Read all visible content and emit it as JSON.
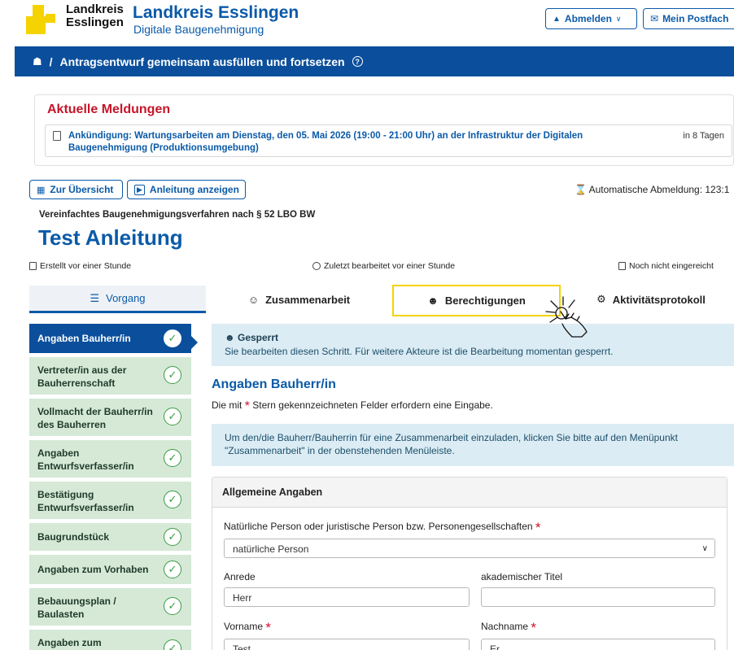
{
  "header": {
    "logo_line1": "Landkreis",
    "logo_line2": "Esslingen",
    "title": "Landkreis Esslingen",
    "subtitle": "Digitale Baugenehmigung",
    "logout_label": "Abmelden",
    "inbox_label": "Mein Postfach"
  },
  "bluebar": {
    "separator": "/",
    "title": "Antragsentwurf gemeinsam ausfüllen und fortsetzen",
    "help": "?"
  },
  "news": {
    "title": "Aktuelle Meldungen",
    "items": [
      {
        "text": "Ankündigung: Wartungsarbeiten am Dienstag, den 05. Mai 2026 (19:00 - 21:00 Uhr) an der Infrastruktur der Digitalen Baugenehmigung (Produktionsumgebung)",
        "when": "in 8 Tagen"
      }
    ]
  },
  "actions": {
    "overview_label": "Zur Übersicht",
    "manual_label": "Anleitung anzeigen",
    "autologout": "Automatische Abmeldung: 123:1"
  },
  "procedure": {
    "type": "Vereinfachtes Baugenehmigungsverfahren nach § 52 LBO BW",
    "title": "Test Anleitung",
    "created": "Erstellt vor einer Stunde",
    "edited": "Zuletzt bearbeitet vor einer Stunde",
    "submitted": "Noch nicht eingereicht"
  },
  "tabs": [
    {
      "label": "Vorgang"
    },
    {
      "label": "Zusammenarbeit"
    },
    {
      "label": "Berechtigungen"
    },
    {
      "label": "Aktivitätsprotokoll"
    }
  ],
  "sidebar": {
    "check": "✓",
    "items": [
      {
        "label": "Angaben Bauherr/in"
      },
      {
        "label": "Vertreter/in aus der Bauherrenschaft"
      },
      {
        "label": "Vollmacht der Bauherr/in des Bauherren"
      },
      {
        "label": "Angaben Entwurfsverfasser/in"
      },
      {
        "label": "Bestätigung Entwurfsverfasser/in"
      },
      {
        "label": "Baugrundstück"
      },
      {
        "label": "Angaben zum Vorhaben"
      },
      {
        "label": "Bebauungsplan / Baulasten"
      },
      {
        "label": "Angaben zum"
      }
    ]
  },
  "content": {
    "lock_title": "Gesperrt",
    "lock_text": "Sie bearbeiten diesen Schritt. Für weitere Akteure ist die Bearbeitung momentan gesperrt.",
    "section_title": "Angaben Bauherr/in",
    "req_note_prefix": "Die mit",
    "req_note_suffix": "Stern gekennzeichneten Felder erfordern eine Eingabe.",
    "info_text": "Um den/die Bauherr/Bauherrin für eine Zusammenarbeit einzuladen, klicken Sie bitte auf den Menüpunkt \"Zusammenarbeit\" in der obenstehenden Menüleiste.",
    "star": "*"
  },
  "form": {
    "card_title": "Allgemeine Angaben",
    "person_label": "Natürliche Person oder juristische Person bzw. Personengesellschaften",
    "person_value": "natürliche Person",
    "anrede_label": "Anrede",
    "anrede_value": "Herr",
    "titel_label": "akademischer Titel",
    "titel_value": "",
    "vorname_label": "Vorname",
    "vorname_value": "Test",
    "nachname_label": "Nachname",
    "nachname_value": "Er"
  },
  "colors": {
    "brand_blue": "#0b5aa8",
    "bar_blue": "#0b4f9c",
    "news_red": "#c4162a",
    "logo_yellow": "#f5d300",
    "sidebar_green": "#d5e9d6",
    "highlight_yellow": "#f5d300"
  }
}
